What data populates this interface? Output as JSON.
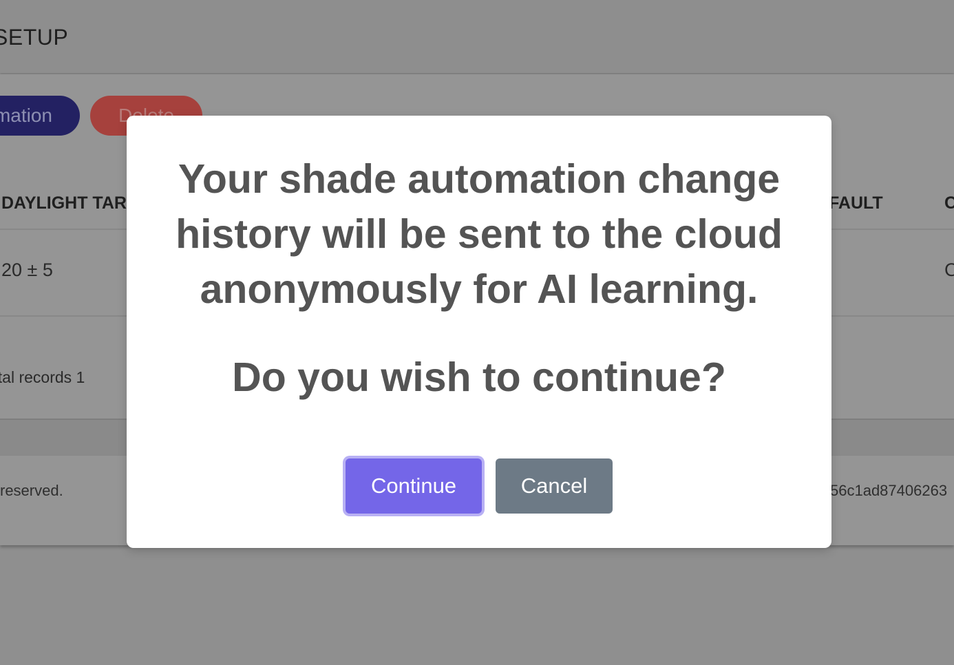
{
  "header": {
    "title": "SETUP"
  },
  "toolbar": {
    "automation_button_label": "mation",
    "delete_button_label": "Delete"
  },
  "table": {
    "columns": [
      "DAYLIGHT TAR",
      "FAULT",
      "C"
    ],
    "rows": [
      [
        "20 ± 5",
        "",
        "C"
      ]
    ],
    "total_records_text": "otal records 1"
  },
  "footer": {
    "left_text": "reserved.",
    "right_text": "56c1ad87406263"
  },
  "modal": {
    "message": "Your shade automation change history will be sent to the cloud anonymously for AI learning.",
    "question": "Do you wish to continue?",
    "continue_label": "Continue",
    "cancel_label": "Cancel"
  },
  "colors": {
    "overlay": "#8f8f8f",
    "continue_button": "#7466e8",
    "cancel_button": "#6d7a86",
    "automation_button": "#232162",
    "delete_button": "#a6413d",
    "modal_text": "#545454"
  }
}
